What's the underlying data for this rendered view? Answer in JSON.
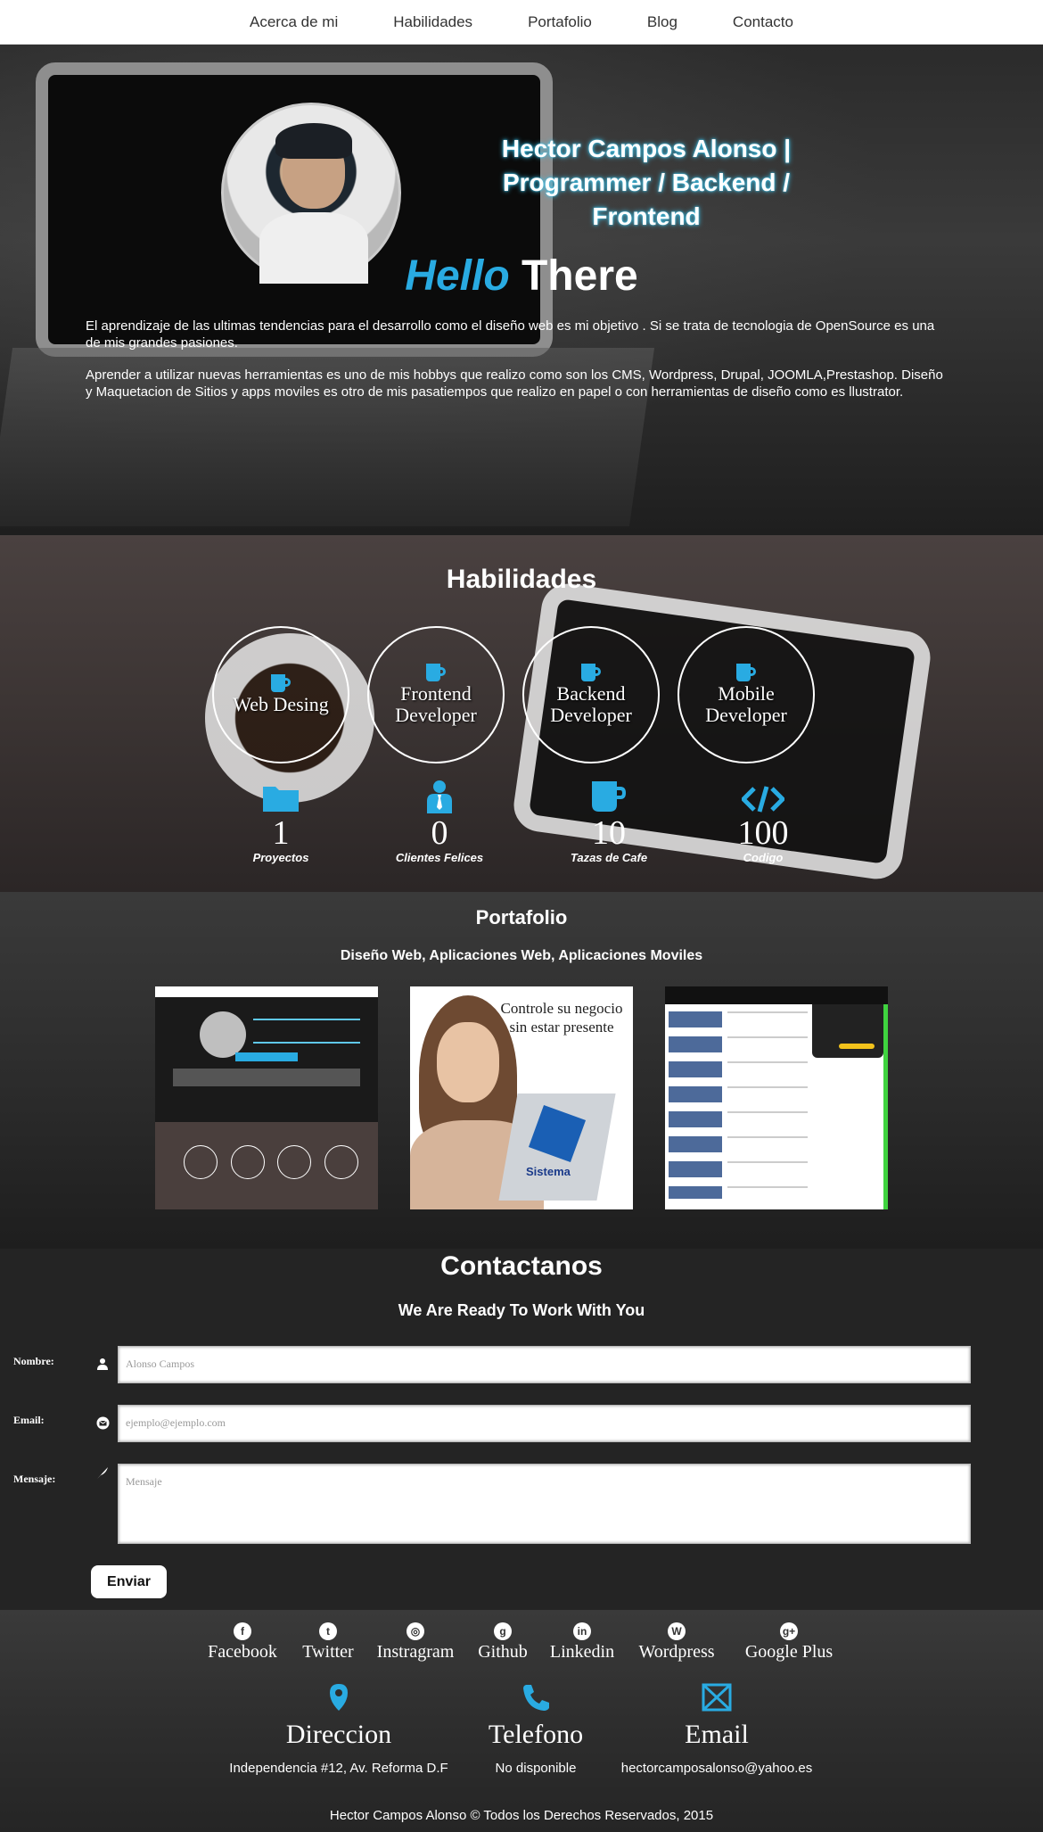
{
  "nav": {
    "items": [
      "Acerca de mi",
      "Habilidades",
      "Portafolio",
      "Blog",
      "Contacto"
    ]
  },
  "hero": {
    "title": "Hector Campos Alonso | Programmer / Backend / Frontend",
    "hello_1": "Hello",
    "hello_2": "There",
    "p1": "El aprendizaje de las ultimas tendencias para el desarrollo como el diseño web es mi objetivo . Si se trata de tecnologia de OpenSource es una de mis grandes pasiones.",
    "p2": "Aprender a utilizar nuevas herramientas es uno de mis hobbys que realizo como son los CMS, Wordpress, Drupal, JOOMLA,Prestashop. Diseño y Maquetacion de Sitios y apps moviles es otro de mis pasatiempos que realizo en papel o con herramientas de diseño como es llustrator."
  },
  "skills": {
    "title": "Habilidades",
    "circles": [
      "Web Desing",
      "Frontend Developer",
      "Backend Developer",
      "Mobile Developer"
    ],
    "stats": [
      {
        "num": "1",
        "cap": "Proyectos",
        "icon": "folder-icon"
      },
      {
        "num": "0",
        "cap": "Clientes Felices",
        "icon": "user-tie-icon"
      },
      {
        "num": "10",
        "cap": "Tazas de Cafe",
        "icon": "coffee-cup-icon"
      },
      {
        "num": "100",
        "cap": "Codigo",
        "icon": "code-icon"
      }
    ]
  },
  "portfolio": {
    "title": "Portafolio",
    "subtitle": "Diseño Web, Aplicaciones Web, Aplicaciones Moviles",
    "thumb2_text": "Controle su negocio sin estar presente",
    "thumb2_brand": "Sistema"
  },
  "contact": {
    "title": "Contactanos",
    "subtitle": "We Are Ready To Work With You",
    "name_label": "Nombre:",
    "name_placeholder": "Alonso Campos",
    "email_label": "Email:",
    "email_placeholder": "ejemplo@ejemplo.com",
    "message_label": "Mensaje:",
    "message_placeholder": "Mensaje",
    "send_label": "Enviar"
  },
  "footer": {
    "social": [
      {
        "label": "Facebook",
        "icon": "facebook-icon"
      },
      {
        "label": "Twitter",
        "icon": "twitter-icon"
      },
      {
        "label": "Instragram",
        "icon": "instagram-icon"
      },
      {
        "label": "Github",
        "icon": "github-icon"
      },
      {
        "label": "Linkedin",
        "icon": "linkedin-icon"
      },
      {
        "label": "Wordpress",
        "icon": "wordpress-icon"
      },
      {
        "label": "Google  Plus",
        "icon": "google-plus-icon"
      }
    ],
    "info": [
      {
        "label": "Direccion",
        "value": "Independencia #12, Av. Reforma D.F",
        "icon": "map-pin-icon"
      },
      {
        "label": "Telefono",
        "value": "No disponible",
        "icon": "phone-icon"
      },
      {
        "label": "Email",
        "value": "hectorcamposalonso@yahoo.es",
        "icon": "envelope-icon"
      }
    ],
    "copyright": "Hector Campos Alonso © Todos los Derechos Reservados, 2015"
  },
  "colors": {
    "accent": "#29abe2",
    "nav_bg": "#ffffff",
    "contact_bg": "#242424"
  }
}
